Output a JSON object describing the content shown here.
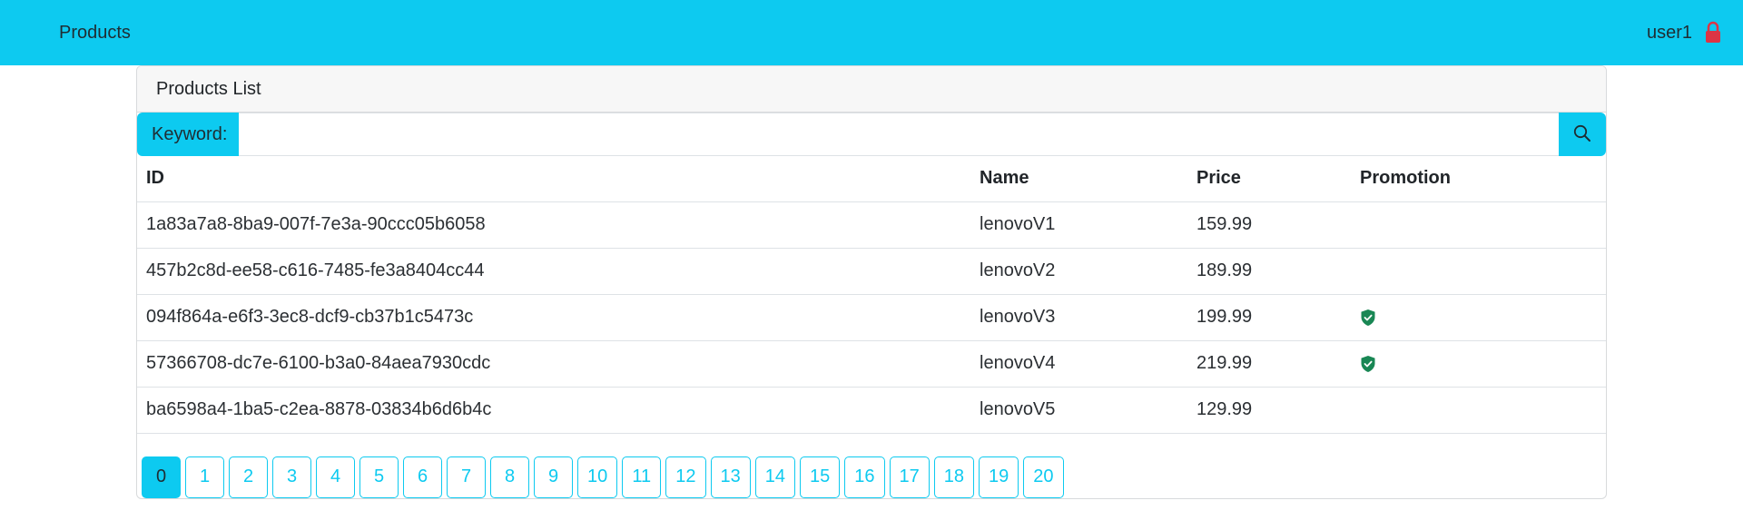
{
  "navbar": {
    "brand": "Products",
    "username": "user1",
    "logout_icon": "lock-icon",
    "logout_icon_color": "#dc3545"
  },
  "card": {
    "title": "Products List"
  },
  "search": {
    "label": "Keyword:",
    "value": "",
    "placeholder": "",
    "button_icon": "search-icon"
  },
  "table": {
    "headers": [
      "ID",
      "Name",
      "Price",
      "Promotion"
    ],
    "rows": [
      {
        "id": "1a83a7a8-8ba9-007f-7e3a-90ccc05b6058",
        "name": "lenovoV1",
        "price": "159.99",
        "promotion": false
      },
      {
        "id": "457b2c8d-ee58-c616-7485-fe3a8404cc44",
        "name": "lenovoV2",
        "price": "189.99",
        "promotion": false
      },
      {
        "id": "094f864a-e6f3-3ec8-dcf9-cb37b1c5473c",
        "name": "lenovoV3",
        "price": "199.99",
        "promotion": true
      },
      {
        "id": "57366708-dc7e-6100-b3a0-84aea7930cdc",
        "name": "lenovoV4",
        "price": "219.99",
        "promotion": true
      },
      {
        "id": "ba6598a4-1ba5-c2ea-8878-03834b6d6b4c",
        "name": "lenovoV5",
        "price": "129.99",
        "promotion": false
      }
    ],
    "promotion_icon": "shield-check-icon",
    "promotion_icon_color": "#198754"
  },
  "pagination": {
    "pages": [
      "0",
      "1",
      "2",
      "3",
      "4",
      "5",
      "6",
      "7",
      "8",
      "9",
      "10",
      "11",
      "12",
      "13",
      "14",
      "15",
      "16",
      "17",
      "18",
      "19",
      "20"
    ],
    "current": "0",
    "accent_color": "#0dcaf0"
  }
}
